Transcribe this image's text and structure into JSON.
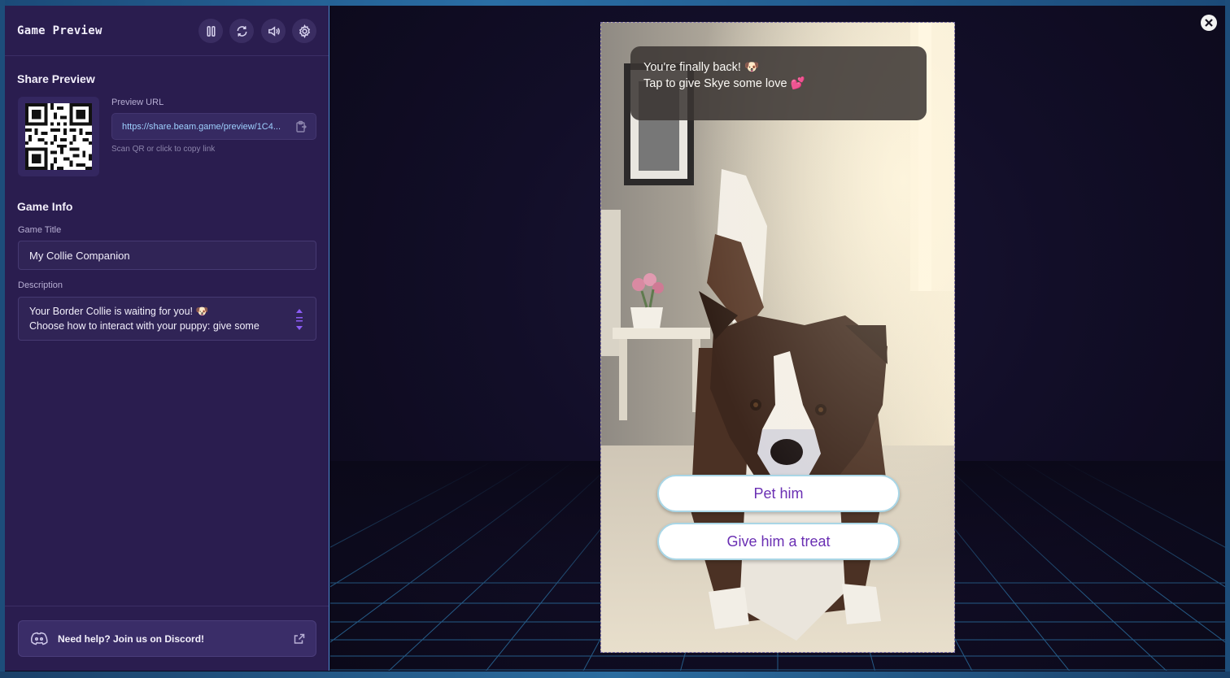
{
  "sidebar": {
    "title": "Game Preview",
    "toolbar": {
      "pause_icon": "pause-icon",
      "restart_icon": "restart-icon",
      "sound_icon": "sound-icon",
      "settings_icon": "gear-icon"
    },
    "share": {
      "heading": "Share Preview",
      "url_label": "Preview URL",
      "url_value": "https://share.beam.game/preview/1C4...",
      "hint": "Scan QR or click to copy link"
    },
    "game_info": {
      "heading": "Game Info",
      "title_label": "Game Title",
      "title_value": "My Collie Companion",
      "description_label": "Description",
      "description_line1": "Your Border Collie is waiting for you! 🐶",
      "description_line2": "Choose how to interact with your puppy: give some"
    },
    "discord": {
      "label": "Need help? Join us on Discord!"
    }
  },
  "preview": {
    "dialogue_line1": "You're finally back! 🐶",
    "dialogue_line2": "Tap to give Skye some love 💕",
    "choices": [
      "Pet him",
      "Give him a treat"
    ]
  },
  "colors": {
    "sidebar_bg": "#2a1d4f",
    "accent_border": "#4b8ad0",
    "choice_text": "#6a2fb3",
    "url_text": "#9fd1ff"
  }
}
